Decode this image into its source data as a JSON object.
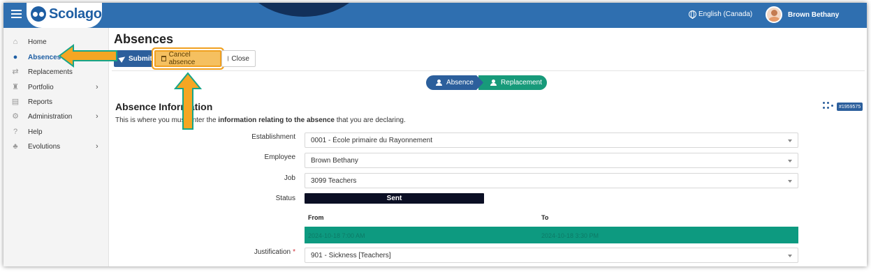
{
  "app": {
    "logo_text": "Scolago",
    "language": "English (Canada)",
    "user_name": "Brown Bethany"
  },
  "sidebar": {
    "items": [
      {
        "label": "Home",
        "icon": "home-icon",
        "active": false,
        "has_submenu": false
      },
      {
        "label": "Absences",
        "icon": "user-absence-icon",
        "active": true,
        "has_submenu": false
      },
      {
        "label": "Replacements",
        "icon": "swap-icon",
        "active": false,
        "has_submenu": false
      },
      {
        "label": "Portfolio",
        "icon": "trophy-icon",
        "active": false,
        "has_submenu": true
      },
      {
        "label": "Reports",
        "icon": "report-icon",
        "active": false,
        "has_submenu": false
      },
      {
        "label": "Administration",
        "icon": "gear-icon",
        "active": false,
        "has_submenu": true
      },
      {
        "label": "Help",
        "icon": "question-icon",
        "active": false,
        "has_submenu": false
      },
      {
        "label": "Evolutions",
        "icon": "sprout-icon",
        "active": false,
        "has_submenu": true
      }
    ],
    "chevron": "›"
  },
  "page": {
    "title": "Absences"
  },
  "toolbar": {
    "submit_label": "Submit",
    "cancel_label": "Cancel absence",
    "close_label": "Close"
  },
  "steps": [
    {
      "label": "Absence",
      "color": "#2c5f9c"
    },
    {
      "label": "Replacement",
      "color": "#179a7a"
    }
  ],
  "section": {
    "title": "Absence Information",
    "desc_prefix": "This is where you must enter the ",
    "desc_bold": "information relating to the absence",
    "desc_suffix": " that you are declaring.",
    "id_badge": "#1959575"
  },
  "form": {
    "establishment_label": "Establishment",
    "establishment_value": "0001 - École primaire du Rayonnement",
    "employee_label": "Employee",
    "employee_value": "Brown Bethany",
    "job_label": "Job",
    "job_value": "3099 Teachers",
    "status_label": "Status",
    "status_value": "Sent",
    "from_header": "From",
    "to_header": "To",
    "from_value": "2024-10-18 7:00 AM",
    "to_value": "2024-10-18 3:30 PM",
    "justification_label": "Justification",
    "justification_required": "*",
    "justification_value": "901 - Sickness [Teachers]"
  },
  "colors": {
    "header": "#2f6fb0",
    "primary": "#2c5f9c",
    "success": "#0d9a80",
    "highlight": "#f0a020",
    "status_sent": "#0b0f24"
  }
}
